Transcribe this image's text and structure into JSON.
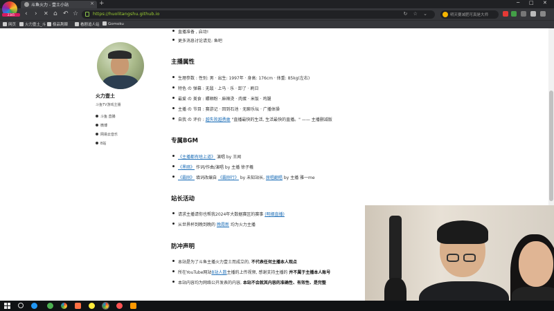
{
  "browser": {
    "app_logo_text": "2345",
    "tab_title": "斗鱼火力 - 壹土小站",
    "new_tab": "+",
    "window_controls": [
      "─",
      "□",
      "✕"
    ],
    "nav": {
      "back": "‹",
      "forward": "›",
      "reload": "✕",
      "home": "⌂",
      "undo": "↶",
      "star": "☆"
    },
    "url": "https://huolitangshu.github.io",
    "url_icons": "↻ ☆ ⌄",
    "search_placeholder": "明天要减肥可真是大师",
    "bookmarks": [
      "网页",
      "火力壹土_斗",
      "极品荆棘",
      "看剧追人站",
      "Gomoku"
    ]
  },
  "profile": {
    "name": "火力壹土",
    "subtitle": "斗鱼TV游戏主播",
    "links": [
      "斗鱼 直播",
      "微博",
      "网易云音乐",
      "B站"
    ]
  },
  "content": {
    "top_items": [
      "直播准备 , 启动!",
      "更多消息讨论请见: 鱼吧"
    ],
    "section1_title": "主播属性",
    "attributes": [
      {
        "label": "生理参数 :",
        "value": "性别: 男 · 出生: 1997年 · 身高: 176cm · 体重: 85kg(左右)"
      },
      {
        "label": "特色 の 弹幕 :",
        "value": "无敌 · 上马 · 乐 · 卸了 · 刷日"
      },
      {
        "label": "最爱 の 美食 :",
        "value": "螺蛳粉 · 麻辣烫 · 肉蛋 · 米饭 · 鸡腿"
      },
      {
        "label": "主播 の 节目 :",
        "value": "赛游记 · 回到石池 · 无聊乐坛 · 广播体操"
      },
      {
        "label": "自我 の 评价 :",
        "link": "越失败越勇敢",
        "value": "\"直播最快的生活, 生活最快的直播。\" —— 主播删减版"
      }
    ],
    "section2_title": "专属BGM",
    "bgm": [
      {
        "link": "《主播都有啥上道》",
        "value": "演唱 by 王闻"
      },
      {
        "link": "《黑暗》",
        "value": "作词/作曲/演唱 by 主播 徐子羲"
      },
      {
        "link": "《霸刚》",
        "value": "填词改编自",
        "link2": "《霸刚行》",
        "value2": "by 未知站长,",
        "link3": "原唱翻唱",
        "value3": "by 主播 雅一me"
      }
    ],
    "section3_title": "站长活动",
    "events": [
      {
        "value": "请求主播请你也帮我2024年大数据赛区的赛事",
        "link": "(明细直播)"
      },
      {
        "value": "从世界杯到晚到晚的",
        "link": "晚霞新",
        "value2": "均为火力主播"
      }
    ],
    "section4_title": "防冲声明",
    "disclaimers": [
      {
        "value": "本站是为了斗鱼主播火力壹土而成立的,",
        "bold": "不代表任何主播本人观点"
      },
      {
        "value": "所在YouTube网站",
        "link": "B站人数",
        "value2": "主播的上传视频, 感谢支持主播的",
        "bold": "并不属于主播本人账号"
      },
      {
        "value": "本站内容均为网络公开发表的内容,",
        "bold": "本站不会就其内容的准确性、有效性、是完整"
      }
    ]
  },
  "taskbar": {
    "start": "start-menu"
  }
}
